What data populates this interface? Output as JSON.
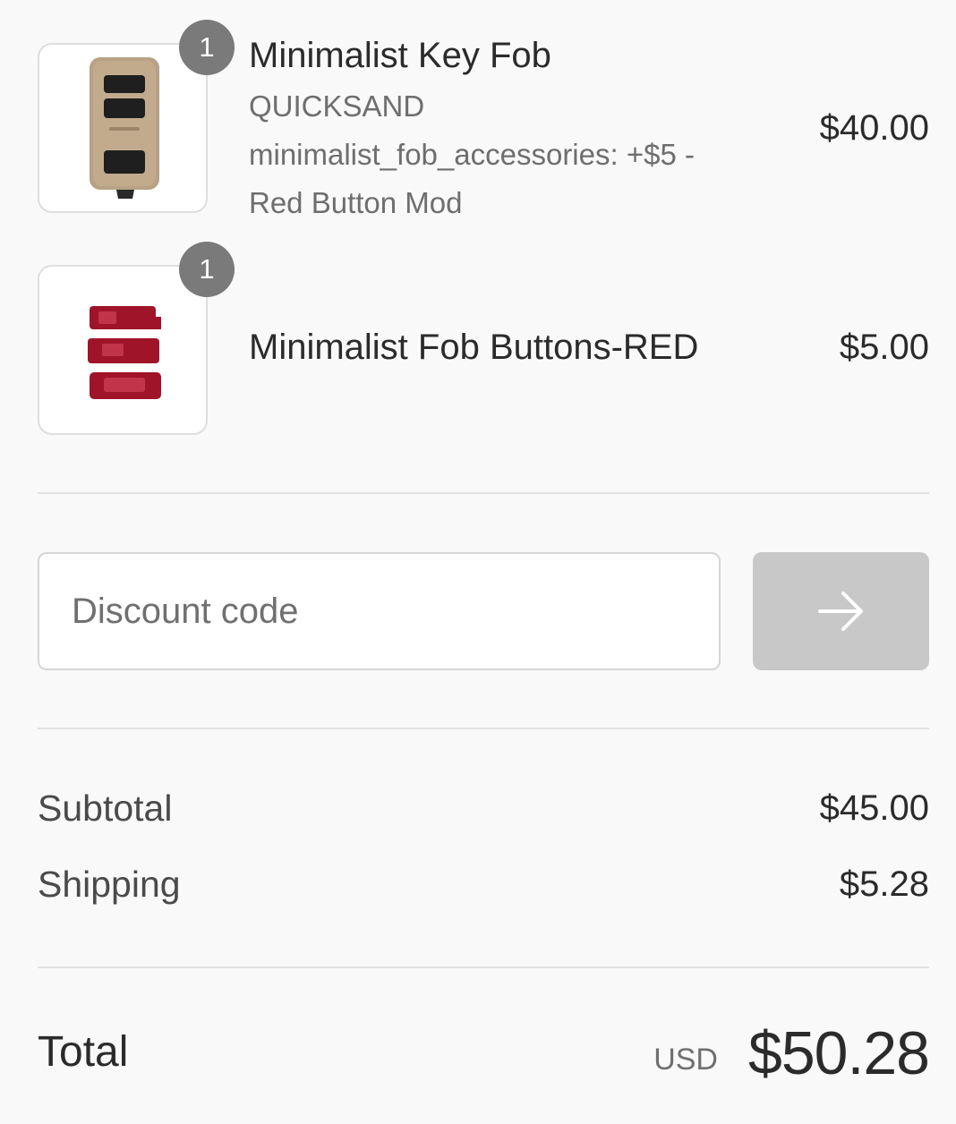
{
  "line_items": [
    {
      "quantity": "1",
      "name": "Minimalist Key Fob",
      "variant": "QUICKSAND",
      "options": [
        "minimalist_fob_accessories: +$5 -",
        "Red Button Mod"
      ],
      "price": "$40.00",
      "image_icon": "tan-key-fob-image",
      "image_color": "#b8a184"
    },
    {
      "quantity": "1",
      "name": "Minimalist Fob Buttons-RED",
      "price": "$5.00",
      "image_icon": "red-fob-buttons-image",
      "image_color": "#a0142a"
    }
  ],
  "discount": {
    "placeholder": "Discount code",
    "apply_icon": "arrow-right-icon"
  },
  "summary": {
    "subtotal_label": "Subtotal",
    "subtotal_value": "$45.00",
    "shipping_label": "Shipping",
    "shipping_value": "$5.28"
  },
  "total": {
    "label": "Total",
    "currency": "USD",
    "value": "$50.28"
  },
  "colors": {
    "background": "#f9f9f9",
    "badge": "#7a7a7a",
    "apply_button": "#c8c8c8",
    "text_primary": "#2b2b2b",
    "text_secondary": "#6e6e6e"
  }
}
